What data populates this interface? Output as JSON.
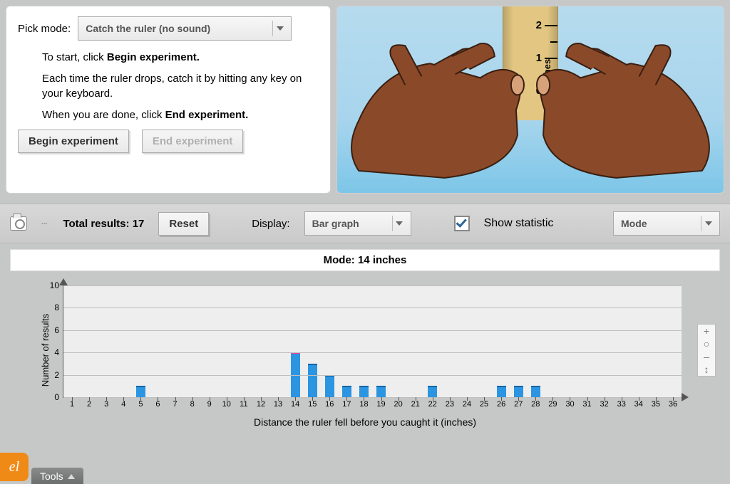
{
  "controls": {
    "mode_label": "Pick mode:",
    "mode_value": "Catch the ruler (no sound)",
    "instr1_pre": "To start, click ",
    "instr1_bold": "Begin experiment.",
    "instr2": "Each time the ruler drops, catch it by hitting any key on your keyboard.",
    "instr3_pre": "When you are done, click ",
    "instr3_bold": "End experiment.",
    "begin_label": "Begin experiment",
    "end_label": "End experiment"
  },
  "ruler": {
    "ticks": [
      "2",
      "1",
      "0"
    ],
    "unit": "inches"
  },
  "results_bar": {
    "total_label_pre": "Total results: ",
    "total_value": "17",
    "reset_label": "Reset",
    "display_label": "Display:",
    "display_value": "Bar graph",
    "show_stat_label": "Show statistic",
    "show_stat_checked": true,
    "stat_value": "Mode"
  },
  "chart_header": "Mode: 14 inches",
  "chart_data": {
    "type": "bar",
    "title": "Mode: 14 inches",
    "xlabel": "Distance the ruler fell before you caught it (inches)",
    "ylabel": "Number of results",
    "ylim": [
      0,
      10
    ],
    "yticks": [
      0,
      2,
      4,
      6,
      8,
      10
    ],
    "categories": [
      1,
      2,
      3,
      4,
      5,
      6,
      7,
      8,
      9,
      10,
      11,
      12,
      13,
      14,
      15,
      16,
      17,
      18,
      19,
      20,
      21,
      22,
      23,
      24,
      25,
      26,
      27,
      28,
      29,
      30,
      31,
      32,
      33,
      34,
      35,
      36
    ],
    "values": [
      0,
      0,
      0,
      0,
      1,
      0,
      0,
      0,
      0,
      0,
      0,
      0,
      0,
      4,
      3,
      2,
      1,
      1,
      1,
      0,
      0,
      1,
      0,
      0,
      0,
      1,
      1,
      1,
      0,
      0,
      0,
      0,
      0,
      0,
      0,
      0
    ],
    "highlight_index": 13,
    "bar_color": "#2b95e2",
    "highlight_color": "#f0419c"
  },
  "zoom": {
    "plus": "+",
    "minus": "–",
    "arrow": "↕"
  },
  "tools_label": "Tools",
  "badge_text": "el"
}
